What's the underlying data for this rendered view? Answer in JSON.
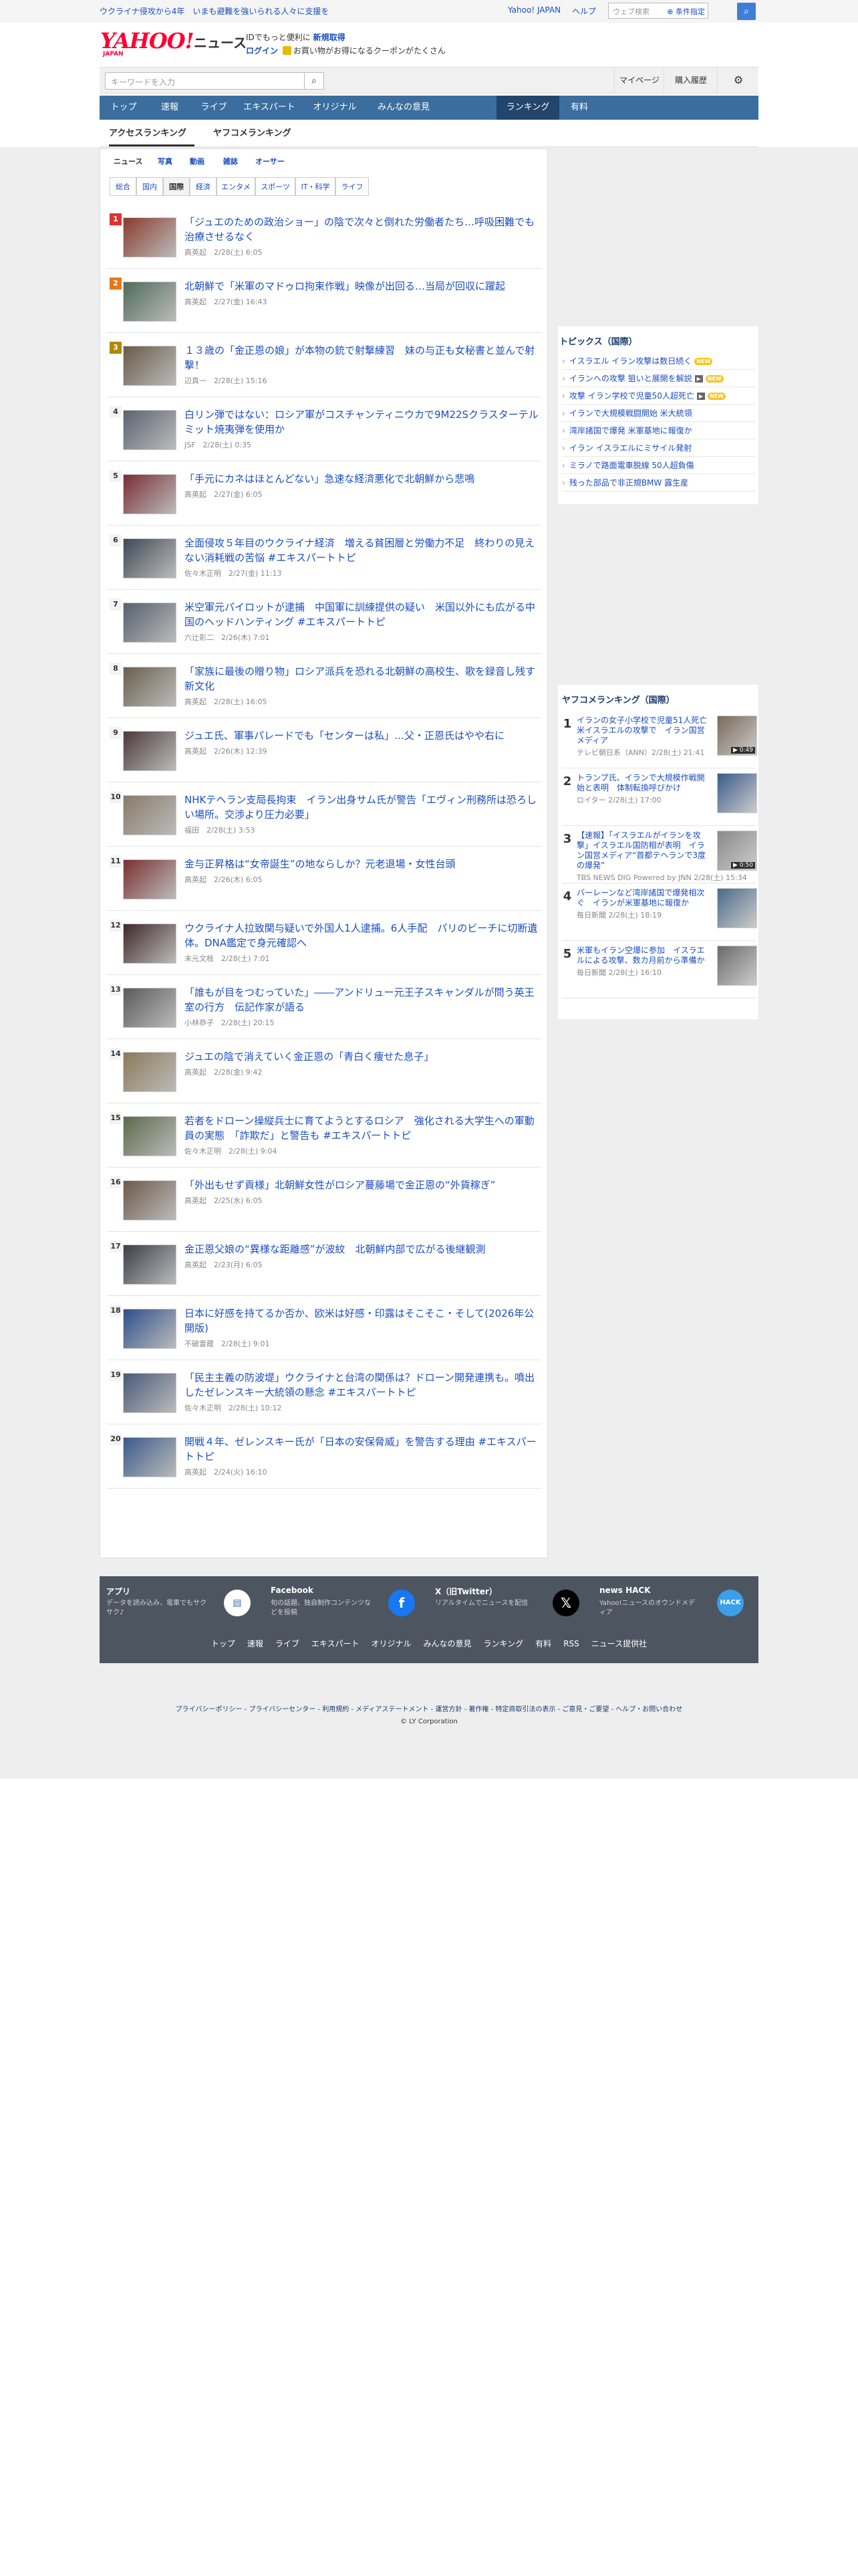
{
  "topbar": {
    "notice": "ウクライナ侵攻から4年　いまも避難を強いられる人々に支援を",
    "links": [
      "Yahoo! JAPAN",
      "ヘルプ"
    ],
    "web_search_placeholder": "ウェブ検索",
    "advanced_search": "条件指定"
  },
  "header": {
    "logo_text": "YAHOO!",
    "logo_sub": "JAPAN",
    "service_name": "ニュース",
    "promo_line1_a": "IDでもっと便利に",
    "promo_line1_b": "新規取得",
    "promo_login": "ログイン",
    "promo_line2": "お買い物がお得になるクーポンがたくさん"
  },
  "search": {
    "placeholder": "キーワードを入力",
    "mypage": "マイページ",
    "purchase_history": "購入履歴"
  },
  "global_nav": [
    "トップ",
    "速報",
    "ライブ",
    "エキスパート",
    "オリジナル",
    "みんなの意見",
    "ランキング",
    "有料"
  ],
  "sub_tabs": [
    "アクセスランキング",
    "ヤフコメランキング"
  ],
  "media_tabs": [
    "ニュース",
    "写真",
    "動画",
    "雑誌",
    "オーサー"
  ],
  "category_tabs": [
    "総合",
    "国内",
    "国際",
    "経済",
    "エンタメ",
    "スポーツ",
    "IT・科学",
    "ライフ"
  ],
  "ranking": [
    {
      "rank": "1",
      "title": "「ジュエのための政治ショー」の陰で次々と倒れた労働者たち…呼吸困難でも治療させるなく",
      "meta": "高英起　2/28(土) 6:05"
    },
    {
      "rank": "2",
      "title": "北朝鮮で「米軍のマドゥロ拘束作戦」映像が出回る…当局が回収に躍起",
      "meta": "高英起　2/27(金) 16:43"
    },
    {
      "rank": "3",
      "title": "１３歳の「金正恩の娘」が本物の銃で射撃練習　妹の与正も女秘書と並んで射撃！",
      "meta": "辺真一　2/28(土) 15:16"
    },
    {
      "rank": "4",
      "title": "白リン弾ではない：ロシア軍がコスチャンティニウカで9M22Sクラスターテルミット焼夷弾を使用か",
      "meta": "JSF　2/28(土) 0:35"
    },
    {
      "rank": "5",
      "title": "「手元にカネはほとんどない」急速な経済悪化で北朝鮮から悲鳴",
      "meta": "高英起　2/27(金) 6:05"
    },
    {
      "rank": "6",
      "title": "全面侵攻５年目のウクライナ経済　増える貧困層と労働力不足　終わりの見えない消耗戦の苦悩 #エキスパートトピ",
      "meta": "佐々木正明　2/27(金) 11:13"
    },
    {
      "rank": "7",
      "title": "米空軍元パイロットが逮捕　中国軍に訓練提供の疑い　米国以外にも広がる中国のヘッドハンティング #エキスパートトピ",
      "meta": "六辻彰二　2/26(木) 7:01"
    },
    {
      "rank": "8",
      "title": "「家族に最後の贈り物」ロシア派兵を恐れる北朝鮮の高校生、歌を録音し残す新文化",
      "meta": "高英起　2/28(土) 16:05"
    },
    {
      "rank": "9",
      "title": "ジュエ氏、軍事パレードでも「センターは私」…父・正恩氏はやや右に",
      "meta": "高英起　2/26(木) 12:39"
    },
    {
      "rank": "10",
      "title": "NHKテヘラン支局長拘束　イラン出身サム氏が警告「エヴィン刑務所は恐ろしい場所。交渉より圧力必要」",
      "meta": "福田　2/28(土) 3:53"
    },
    {
      "rank": "11",
      "title": "金与正昇格は“女帝誕生”の地ならしか？元老退場・女性台頭",
      "meta": "高英起　2/26(木) 6:05"
    },
    {
      "rank": "12",
      "title": "ウクライナ人拉致関与疑いで外国人1人逮捕。6人手配　パリのビーチに切断遺体。DNA鑑定で身元確認へ",
      "meta": "末元文枝　2/28(土) 7:01"
    },
    {
      "rank": "13",
      "title": "「誰もが目をつむっていた」――アンドリュー元王子スキャンダルが問う英王室の行方　伝記作家が語る",
      "meta": "小林恭子　2/28(土) 20:15"
    },
    {
      "rank": "14",
      "title": "ジュエの陰で消えていく金正恩の「青白く痩せた息子」",
      "meta": "高英起　2/28(金) 9:42"
    },
    {
      "rank": "15",
      "title": "若者をドローン操縦兵士に育てようとするロシア　強化される大学生への軍動員の実態　「詐欺だ」と警告も #エキスパートトピ",
      "meta": "佐々木正明　2/28(土) 9:04"
    },
    {
      "rank": "16",
      "title": "「外出もせず貢様」北朝鮮女性がロシア蔓藤場で金正恩の“外貨稼ぎ”",
      "meta": "高英起　2/25(水) 6:05"
    },
    {
      "rank": "17",
      "title": "金正恩父娘の“異様な距離感”が波紋　北朝鮮内部で広がる後継観測",
      "meta": "高英起　2/23(月) 6:05"
    },
    {
      "rank": "18",
      "title": "日本に好感を持てるか否か、欧米は好感・印露はそこそこ・そして(2026年公開版)",
      "meta": "不破雷蔵　2/28(土) 9:01"
    },
    {
      "rank": "19",
      "title": "「民主主義の防波堤」ウクライナと台湾の関係は？ドローン開発連携も。噴出したゼレンスキー大統領の懸念 #エキスパートトピ",
      "meta": "佐々木正明　2/28(土) 10:12"
    },
    {
      "rank": "20",
      "title": "開戦４年、ゼレンスキー氏が「日本の安保脅威」を警告する理由 #エキスパートトピ",
      "meta": "高英起　2/24(火) 16:10"
    }
  ],
  "topics": {
    "title": "トピックス（国際）",
    "items": [
      {
        "text": "イスラエル イラン攻撃は数日続く",
        "badge": "NEW"
      },
      {
        "text": "イランへの攻撃 狙いと展開を解説",
        "badge": "NEW",
        "video": "▶"
      },
      {
        "text": "攻撃 イラン学校で児童50人超死亡",
        "badge": "NEW",
        "video": "▶"
      },
      {
        "text": "イランで大規模戦闘開始 米大統領"
      },
      {
        "text": "湾岸諸国で爆発 米軍基地に報復か"
      },
      {
        "text": "イラン イスラエルにミサイル発射"
      },
      {
        "text": "ミラノで路面電車脱線 50人超負傷"
      },
      {
        "text": "残った部品で非正規BMW 露生産"
      }
    ]
  },
  "comment_ranking": {
    "title": "ヤフコメランキング（国際）",
    "items": [
      {
        "rank": "1",
        "title": "イランの女子小学校で児童51人死亡　米イスラエルの攻撃で　イラン国営メディア",
        "meta": "テレビ朝日系（ANN）2/28(土) 21:41",
        "duration": "▶ 0:49"
      },
      {
        "rank": "2",
        "title": "トランプ氏、イランで大規模作戦開始と表明　体制転換呼びかけ",
        "meta": "ロイター 2/28(土) 17:00",
        "duration": ""
      },
      {
        "rank": "3",
        "title": "【速報】「イスラエルがイランを攻撃」イスラエル国防相が表明　イラン国営メディア“首都テヘランで3度の爆発”",
        "meta": "TBS NEWS DIG Powered by JNN 2/28(土) 15:34",
        "duration": "▶ 0:50"
      },
      {
        "rank": "4",
        "title": "バーレーンなど湾岸諸国で爆発相次ぐ　イランが米軍基地に報復か",
        "meta": "毎日新聞 2/28(土) 18:19",
        "duration": ""
      },
      {
        "rank": "5",
        "title": "米軍もイラン空爆に参加　イスラエルによる攻撃、数カ月前から準備か",
        "meta": "毎日新聞 2/28(土) 16:10",
        "duration": ""
      }
    ]
  },
  "footer": {
    "cards": [
      {
        "head": "アプリ",
        "desc": "データを読み込み、電車でもサクサク♪"
      },
      {
        "head": "Facebook",
        "desc": "旬の話題、独自制作コンテンツなどを投稿"
      },
      {
        "head": "X（旧Twitter）",
        "desc": "リアルタイムでニュースを配信"
      },
      {
        "head": "news HACK",
        "desc": "Yahoo!ニュースのオウンドメディア"
      }
    ],
    "nav": [
      "トップ",
      "速報",
      "ライブ",
      "エキスパート",
      "オリジナル",
      "みんなの意見",
      "ランキング",
      "有料",
      "RSS",
      "ニュース提供社"
    ],
    "legal": "プライバシーポリシー - プライバシーセンター - 利用規約 - メディアステートメント - 運営方針 - 著作権 - 特定商取引法の表示 - ご意見・ご要望 - ヘルプ・お問い合わせ",
    "copyright": "© LY Corporation"
  },
  "colors": {
    "brand_red": "#ff0033",
    "nav_blue": "#3b6e9e",
    "link_blue": "#1a4dc2",
    "rank_gold": "#d33",
    "rank_silver": "#e67819",
    "rank_bronze": "#b08a00"
  }
}
